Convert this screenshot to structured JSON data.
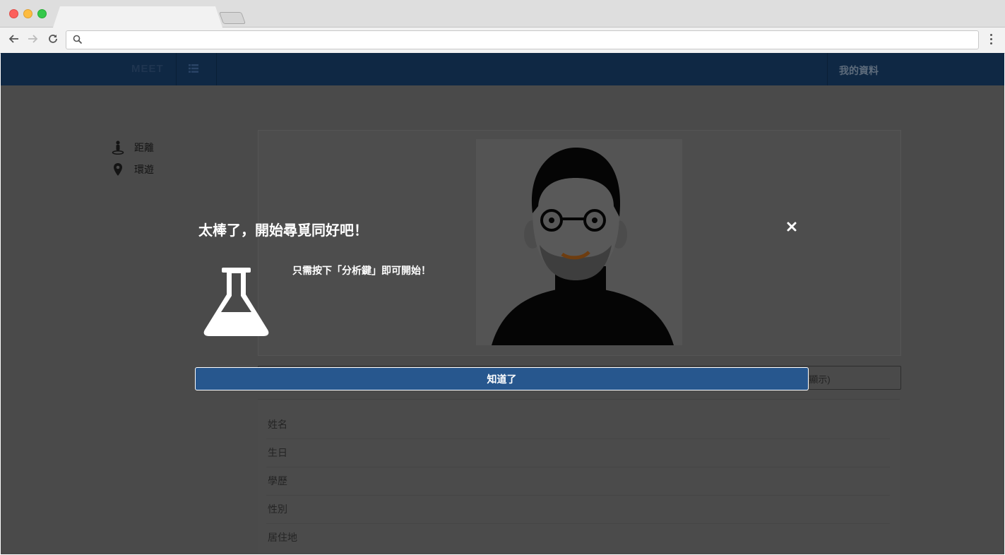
{
  "browser": {
    "address_placeholder": ""
  },
  "nav": {
    "brand": "MEET",
    "my_profile": "我的資料"
  },
  "sidebar": {
    "items": [
      {
        "label": "距離",
        "icon": "person-pin-icon"
      },
      {
        "label": "環遊",
        "icon": "map-marker-icon"
      }
    ]
  },
  "profile": {
    "display_toggle": "(顯示)",
    "fields": [
      "姓名",
      "生日",
      "學歷",
      "性別",
      "居住地"
    ]
  },
  "modal": {
    "title": "太棒了，開始尋覓同好吧！",
    "message": "只需按下「分析鍵」即可開始！",
    "confirm_label": "知道了",
    "icon": "flask-icon"
  },
  "colors": {
    "navbar": "#0f2844",
    "confirm_button": "#27578e",
    "overlay_background": "#4a4a4a"
  }
}
